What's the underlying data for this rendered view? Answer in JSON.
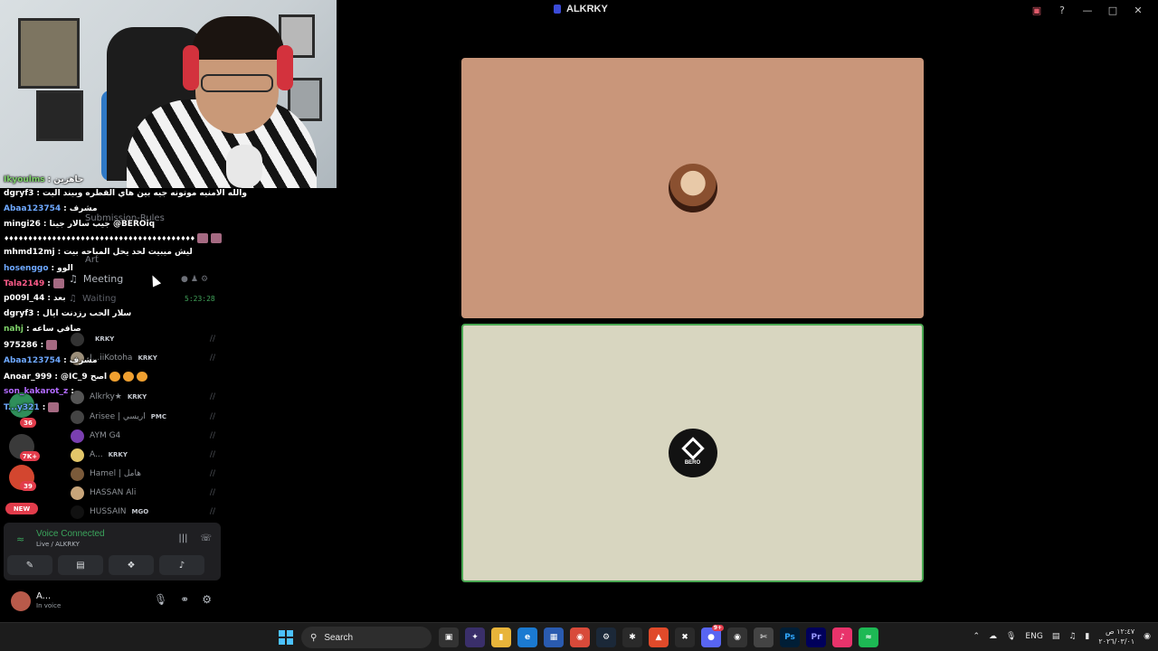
{
  "window": {
    "title": "ALKRKY",
    "controls": [
      "screen-icon",
      "help-icon",
      "minimize-icon",
      "maximize-icon",
      "close-icon"
    ]
  },
  "sidebar": {
    "categories": [
      {
        "label": "Submission-Rules"
      },
      {
        "label": "Art"
      }
    ],
    "voice_channels": [
      {
        "label": "Meeting",
        "icon": "speaker-icon"
      },
      {
        "label": "Waiting",
        "timer": "5:23:28"
      }
    ],
    "server_badges": [
      "36",
      "7K+",
      "39"
    ],
    "new_label": "NEW",
    "members": [
      {
        "name": "",
        "tag": "KRKY"
      },
      {
        "name": "I...iiKotoha",
        "tag": "KRKY"
      },
      {
        "name": "Alkrky★",
        "tag": "KRKY"
      },
      {
        "name": "Arisee | اريسي",
        "tag": "PMC"
      },
      {
        "name": "AYM G4",
        "tag": ""
      },
      {
        "name": "A...",
        "tag": "KRKY"
      },
      {
        "name": "Hamel | هامل",
        "tag": ""
      },
      {
        "name": "HASSAN Ali",
        "tag": ""
      },
      {
        "name": "HUSSAIN",
        "tag": "MGO"
      }
    ]
  },
  "chat": [
    {
      "user": "Ikyoulms",
      "text": "جاهزين"
    },
    {
      "user": "dgryf3",
      "text": "والله الامنيه موتونه جيه بين هاي القطره وبيند اليت"
    },
    {
      "user": "Abaa123754",
      "text": "مشرف"
    },
    {
      "user": "mingi26",
      "text": "جيب سالار جينا @BEROiq"
    },
    {
      "user": "",
      "text": "♦♦♦♦♦♦♦♦♦♦♦♦♦♦♦♦♦♦♦♦♦♦♦♦♦♦♦♦♦♦♦♦♦♦♦♦♦♦♦♦"
    },
    {
      "user": "mhmd12mj",
      "text": "ليش ميبيت لحد يحل المباحه بيت"
    },
    {
      "user": "hosenggo",
      "text": "الوو"
    },
    {
      "user": "Tala2149",
      "text": ""
    },
    {
      "user": "p009l_44",
      "text": "بعد"
    },
    {
      "user": "dgryf3",
      "text": "سلار الحب رزدنت ايال"
    },
    {
      "user": "nahj",
      "text": "صافي ساعه"
    },
    {
      "user": "975286",
      "text": ""
    },
    {
      "user": "Abaa123754",
      "text": "مشرف"
    },
    {
      "user": "Anoar_999",
      "text": "@IC_9 اصح"
    },
    {
      "user": "son_kakarot_z",
      "text": ""
    },
    {
      "user": "T...y321",
      "text": ""
    }
  ],
  "voice_panel": {
    "title": "Voice Connected",
    "subtitle": "Live / ALKRKY"
  },
  "user_bar": {
    "name": "A...",
    "status": "In voice"
  },
  "stage": {
    "tiles": [
      {
        "label": "streamer-avatar",
        "color": "#c9967a"
      },
      {
        "label": "BERO",
        "color": "#d8d6c0",
        "speaking": true
      }
    ]
  },
  "taskbar": {
    "search_label": "Search",
    "language": "ENG",
    "clock_time": "١٢:٤٧ ص",
    "clock_date": "٢٠٢٦/٠٣/٠١",
    "discord_badge": "9+"
  },
  "colors": {
    "accent_green": "#3ba55c",
    "badge_red": "#e23c4b",
    "tile_top": "#c9967a",
    "tile_bottom": "#d8d6c0"
  }
}
